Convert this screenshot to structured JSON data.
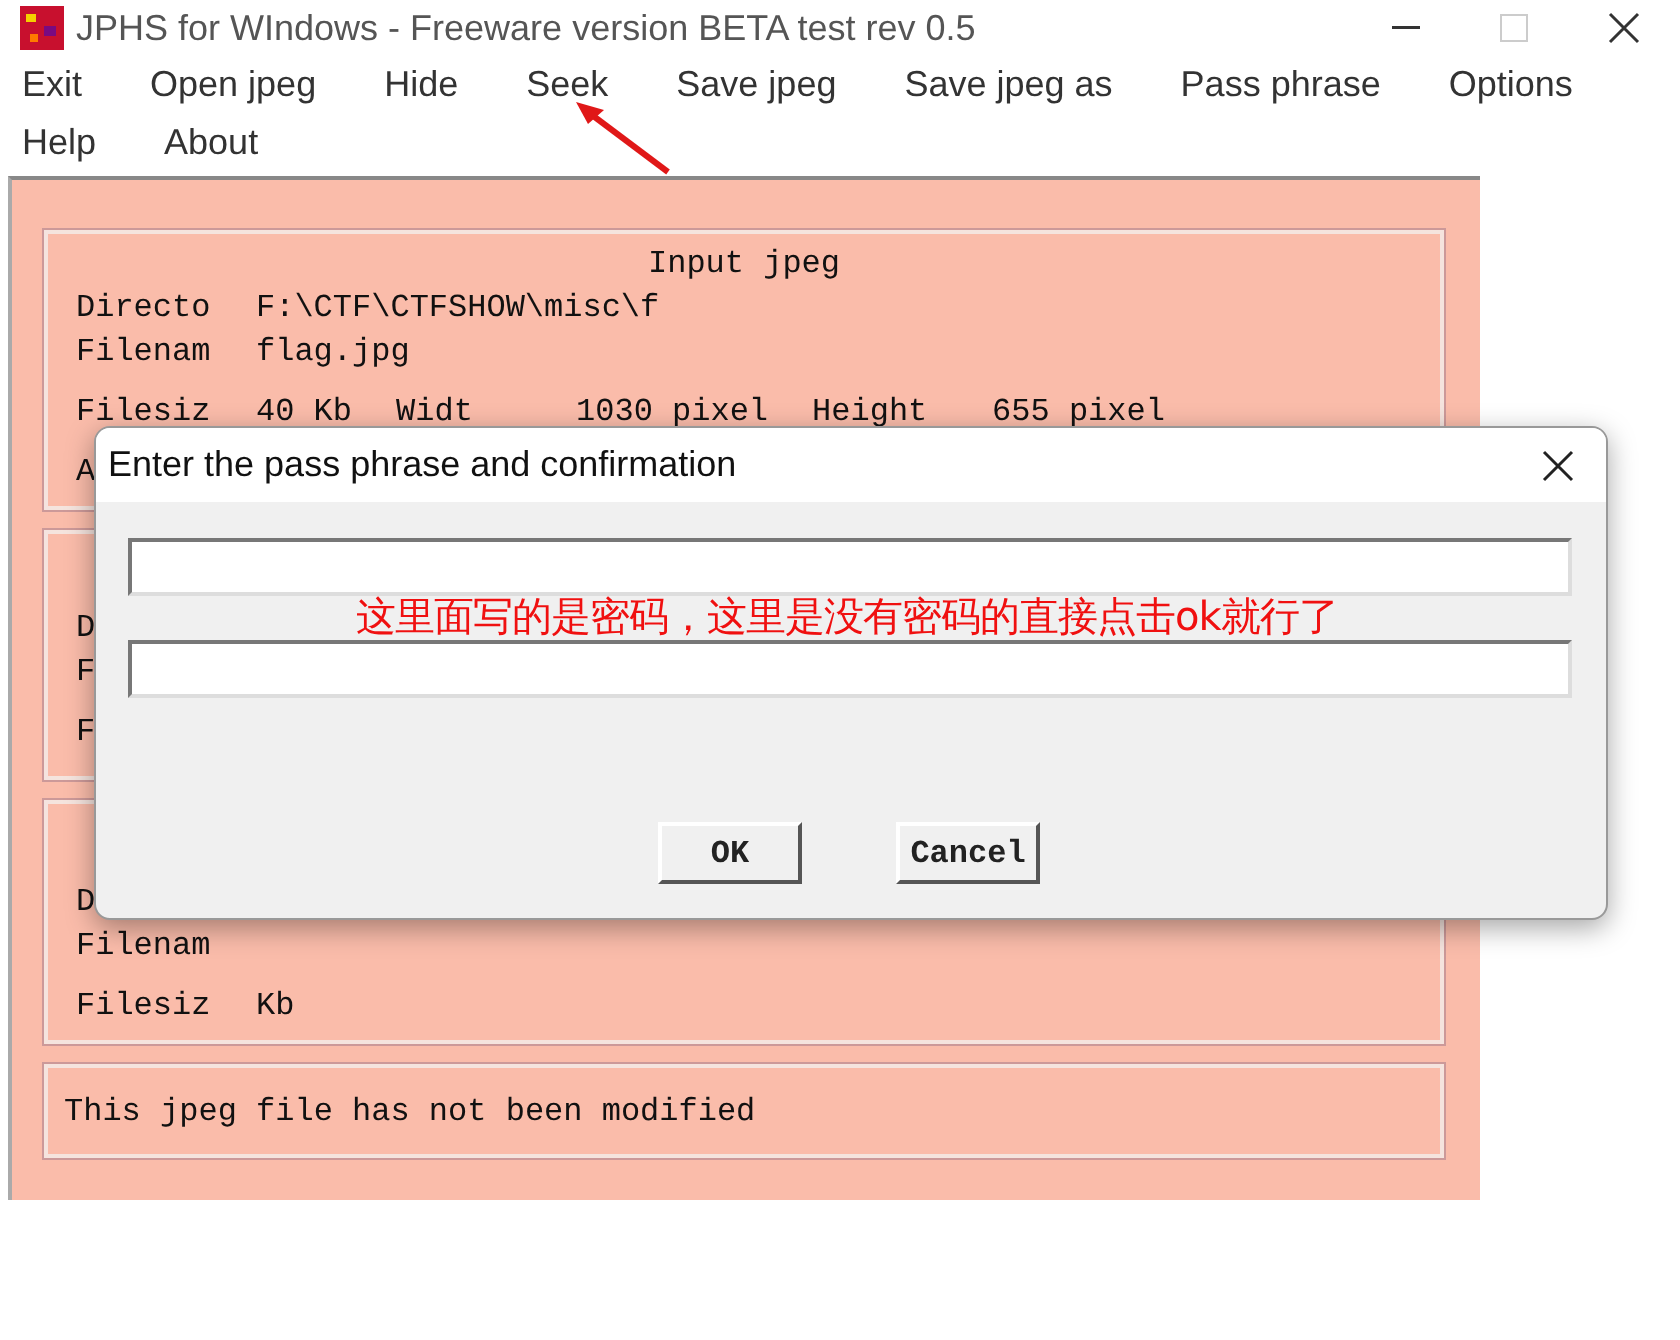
{
  "window": {
    "title": "JPHS for WIndows - Freeware version BETA test rev 0.5"
  },
  "menu_rows": [
    [
      "Exit",
      "Open jpeg",
      "Hide",
      "Seek",
      "Save jpeg",
      "Save jpeg as",
      "Pass phrase",
      "Options"
    ],
    [
      "Help",
      "About"
    ]
  ],
  "panels": [
    {
      "title": "Input jpeg",
      "rows": [
        [
          {
            "label": "Directo",
            "value": "F:\\CTF\\CTFSHOW\\misc\\f"
          }
        ],
        [
          {
            "label": "Filenam",
            "value": "flag.jpg"
          }
        ],
        [
          {
            "label": "Filesiz",
            "value": "40 Kb"
          },
          {
            "label": "Widt",
            "value": "1030 pixel"
          },
          {
            "label": "Height",
            "value": "655 pixel"
          }
        ],
        [
          {
            "label": "A"
          }
        ]
      ]
    },
    {
      "rows": [
        [
          {
            "label": "D"
          }
        ],
        [
          {
            "label": "F"
          }
        ],
        [
          {
            "label": "F"
          }
        ]
      ]
    },
    {
      "rows": [
        [
          {
            "label": "D"
          }
        ],
        [
          {
            "label": "Filenam"
          }
        ],
        [
          {
            "label": "Filesiz",
            "value": "Kb"
          }
        ]
      ]
    },
    {
      "rows": [
        [
          {
            "label": "This jpeg file has not been modified"
          }
        ]
      ]
    }
  ],
  "dialog": {
    "title": "Enter the pass phrase and confirmation",
    "fields": [
      {
        "kind": "text"
      },
      {
        "kind": "text"
      }
    ],
    "buttons": [
      "OK",
      "Cancel"
    ]
  },
  "annotation": {
    "text": "这里面写的是密码，这里是没有密码的直接点击ok就行了"
  }
}
